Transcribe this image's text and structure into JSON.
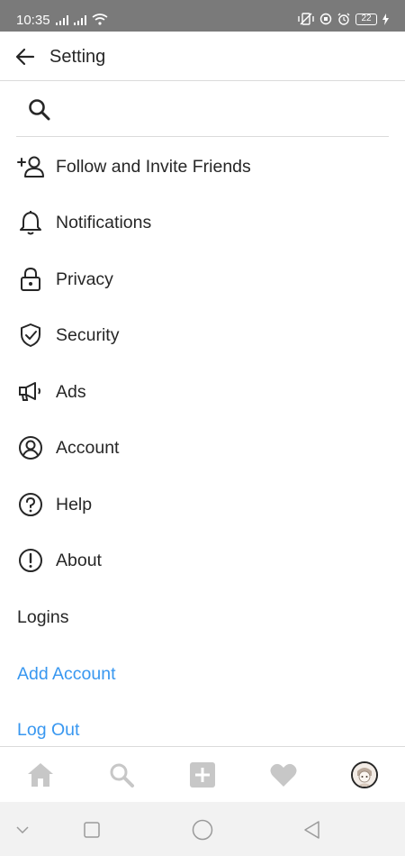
{
  "status_bar": {
    "time": "10:35",
    "battery": "22"
  },
  "header": {
    "title": "Setting",
    "back_icon": "arrow-left-icon"
  },
  "search": {
    "placeholder": "",
    "value": "",
    "icon": "search-icon"
  },
  "menu": {
    "items": [
      {
        "label": "Follow and Invite Friends",
        "icon": "add-person-icon"
      },
      {
        "label": "Notifications",
        "icon": "bell-icon"
      },
      {
        "label": "Privacy",
        "icon": "lock-icon"
      },
      {
        "label": "Security",
        "icon": "shield-check-icon"
      },
      {
        "label": "Ads",
        "icon": "megaphone-icon"
      },
      {
        "label": "Account",
        "icon": "user-circle-icon"
      },
      {
        "label": "Help",
        "icon": "help-circle-icon"
      },
      {
        "label": "About",
        "icon": "info-circle-icon"
      }
    ]
  },
  "logins": {
    "heading": "Logins",
    "add_account": "Add Account",
    "log_out": "Log Out"
  },
  "bottom_nav": {
    "items": [
      "home-icon",
      "search-icon",
      "add-post-icon",
      "heart-icon",
      "avatar"
    ]
  },
  "colors": {
    "status_bar_bg": "#7a7a7a",
    "link_blue": "#3897f0",
    "text": "#262626",
    "icon_gray": "#262626",
    "inactive_nav": "#c7c7c7"
  }
}
